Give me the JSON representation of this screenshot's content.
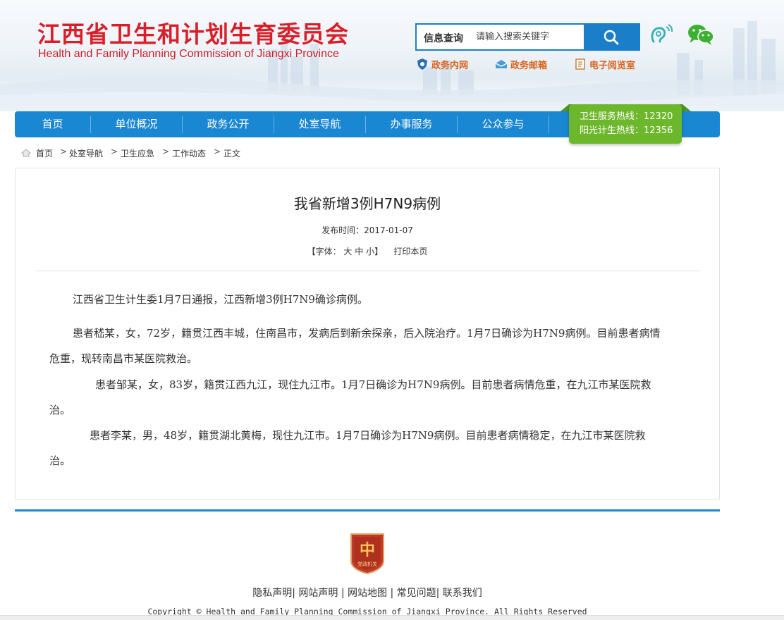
{
  "header": {
    "title": "江西省卫生和计划生育委员会",
    "subtitle": "Health and Family Planning Commission of Jiangxi Province"
  },
  "search": {
    "label": "信息查询",
    "placeholder": "请输入搜索关键字"
  },
  "quick_links": [
    {
      "label": "政务内网",
      "icon": "shield-network-icon"
    },
    {
      "label": "政务邮箱",
      "icon": "mail-icon"
    },
    {
      "label": "电子阅览室",
      "icon": "book-icon"
    }
  ],
  "icons": {
    "accessibility": "hearing-icon",
    "wechat": "wechat-icon"
  },
  "nav": {
    "items": [
      "首页",
      "单位概况",
      "政务公开",
      "处室导航",
      "办事服务",
      "公众参与"
    ]
  },
  "hotline": {
    "line1": "卫生服务热线：12320",
    "line2": "阳光计生热线：12356"
  },
  "breadcrumb": {
    "items": [
      "首页",
      "处室导航",
      "卫生应急",
      "工作动态",
      "正文"
    ],
    "separator": ">"
  },
  "article": {
    "title": "我省新增3例H7N9病例",
    "publish_label": "发布时间：",
    "publish_date": "2017-01-07",
    "font_label": "【字体：",
    "font_large": "大",
    "font_medium": "中",
    "font_small": "小",
    "font_close": "】",
    "print_label": "打印本页",
    "paragraphs": {
      "p1": "江西省卫生计生委1月7日通报，江西新增3例H7N9确诊病例。",
      "p2a": "患者嵇某，女，72岁，籍贯江西丰城，住南昌市，发病后到新余探亲，后入院治疗。1月7日确诊为H7N9病例。目前患者病情",
      "p2b": "危重，现转南昌市某医院救治。",
      "p3a": "患者邹某，女，83岁，籍贯江西九江，现住九江市。1月7日确诊为H7N9病例。目前患者病情危重，在九江市某医院救",
      "p3b": "治。",
      "p4a": "患者李某，男，48岁，籍贯湖北黄梅，现住九江市。1月7日确诊为H7N9病例。目前患者病情稳定，在九江市某医院救",
      "p4b": "治。"
    }
  },
  "footer": {
    "badge_text": "党政机关",
    "links": [
      "隐私声明",
      "网站声明",
      "网站地图",
      "常见问题",
      "联系我们"
    ],
    "copyright": "Copyright © Health and Family Planning Commission of Jiangxi Province. All Rights Reserved"
  },
  "colors": {
    "brand_red": "#d9202a",
    "nav_blue": "#1a87d2",
    "hotline_green": "#6db72c",
    "link_orange": "#d9631c"
  }
}
